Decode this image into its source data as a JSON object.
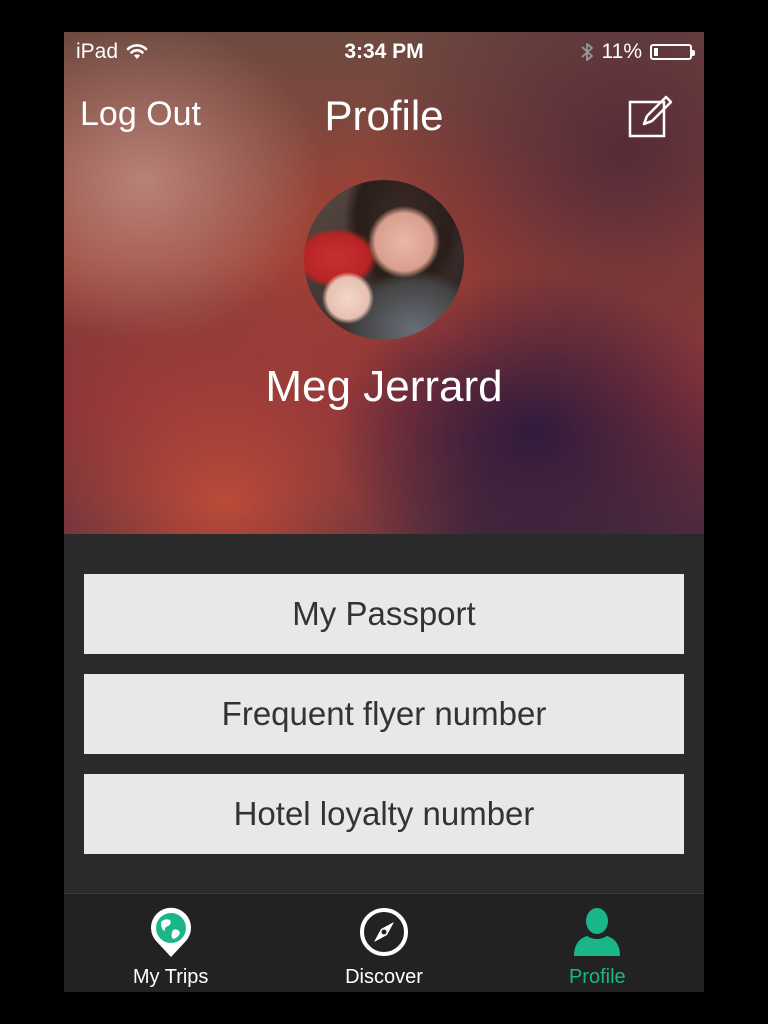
{
  "status_bar": {
    "device": "iPad",
    "time": "3:34 PM",
    "battery": "11%",
    "battery_level": 0.11
  },
  "nav": {
    "left_label": "Log Out",
    "title": "Profile",
    "edit_icon": "edit-icon"
  },
  "profile": {
    "name": "Meg Jerrard"
  },
  "options": [
    {
      "label": "My Passport"
    },
    {
      "label": "Frequent flyer number"
    },
    {
      "label": "Hotel loyalty number"
    }
  ],
  "tabbar": {
    "items": [
      {
        "label": "My Trips",
        "icon": "map-pin-globe-icon",
        "active": false
      },
      {
        "label": "Discover",
        "icon": "compass-icon",
        "active": false
      },
      {
        "label": "Profile",
        "icon": "person-icon",
        "active": true
      }
    ],
    "active_color": "#1bb58a"
  }
}
